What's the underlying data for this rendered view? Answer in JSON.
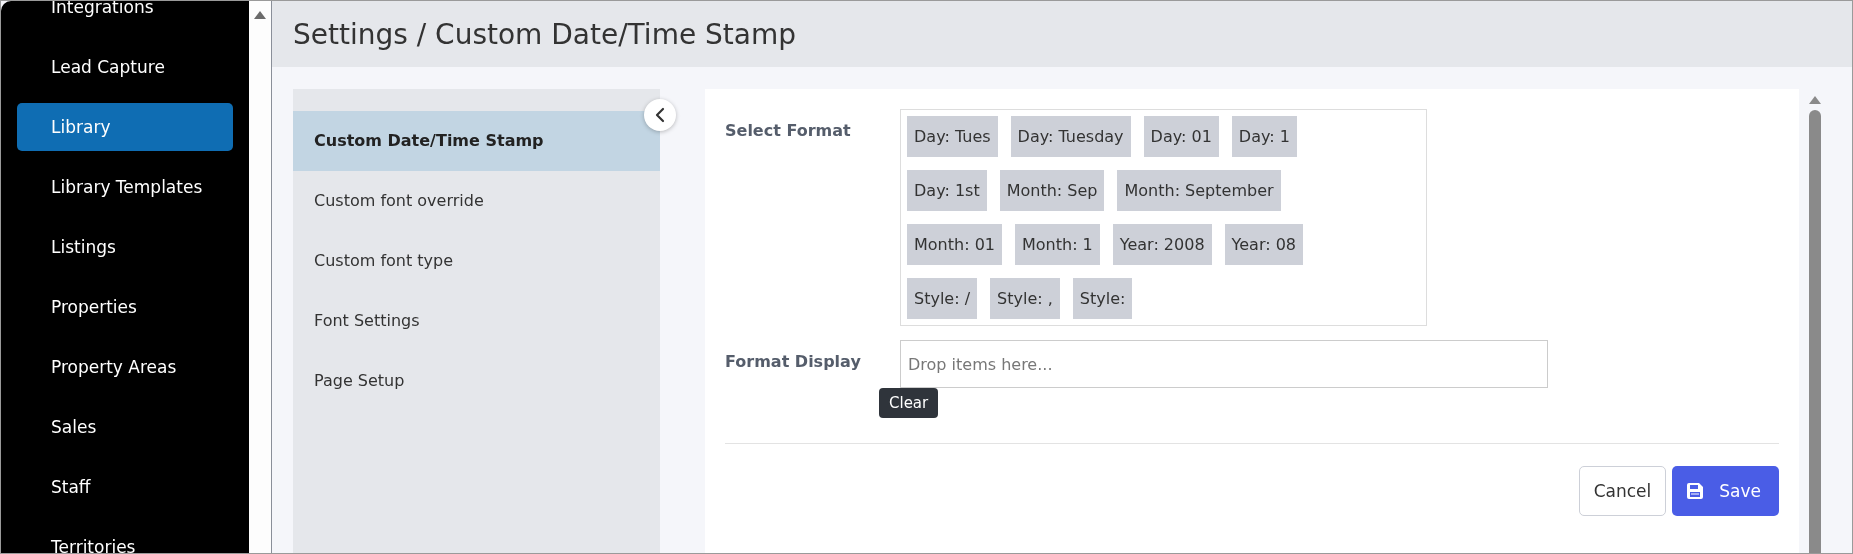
{
  "sidebar": {
    "items": [
      {
        "label": "Integrations",
        "selected": false
      },
      {
        "label": "Lead Capture",
        "selected": false
      },
      {
        "label": "Library",
        "selected": true
      },
      {
        "label": "Library Templates",
        "selected": false
      },
      {
        "label": "Listings",
        "selected": false
      },
      {
        "label": "Properties",
        "selected": false
      },
      {
        "label": "Property Areas",
        "selected": false
      },
      {
        "label": "Sales",
        "selected": false
      },
      {
        "label": "Staff",
        "selected": false
      },
      {
        "label": "Territories",
        "selected": false
      }
    ]
  },
  "header": {
    "title": "Settings / Custom Date/Time Stamp"
  },
  "settings_nav": {
    "items": [
      {
        "label": "Custom Date/Time Stamp",
        "selected": true
      },
      {
        "label": "Custom font override",
        "selected": false
      },
      {
        "label": "Custom font type",
        "selected": false
      },
      {
        "label": "Font Settings",
        "selected": false
      },
      {
        "label": "Page Setup",
        "selected": false
      }
    ]
  },
  "form": {
    "select_format": {
      "label": "Select Format",
      "chip_rows": [
        [
          "Day: Tues",
          "Day: Tuesday",
          "Day: 01",
          "Day: 1"
        ],
        [
          "Day: 1st",
          "Month: Sep",
          "Month: September"
        ],
        [
          "Month: 01",
          "Month: 1",
          "Year: 2008",
          "Year: 08"
        ],
        [
          "Style: /",
          "Style: ,",
          "Style:"
        ]
      ]
    },
    "format_display": {
      "label": "Format Display",
      "placeholder": "Drop items here...",
      "tooltip": "Clear"
    },
    "buttons": [
      {
        "label": "Cancel",
        "kind": "secondary"
      },
      {
        "label": "Save",
        "kind": "primary"
      }
    ]
  }
}
